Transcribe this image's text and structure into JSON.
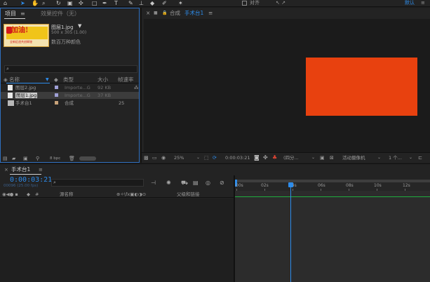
{
  "toolbar": {
    "tools": [
      {
        "icon": "home-icon",
        "glyph": "⌂"
      },
      {
        "icon": "selection-tool-icon",
        "glyph": "➤"
      },
      {
        "icon": "hand-tool-icon",
        "glyph": "✋"
      },
      {
        "icon": "zoom-tool-icon",
        "glyph": "⌕"
      },
      {
        "icon": "rotate-tool-icon",
        "glyph": "↻"
      },
      {
        "icon": "camera-tool-icon",
        "glyph": "▣"
      },
      {
        "icon": "pan-behind-tool-icon",
        "glyph": "✣"
      },
      {
        "icon": "rectangle-tool-icon",
        "glyph": "□"
      },
      {
        "icon": "pen-tool-icon",
        "glyph": "✒"
      },
      {
        "icon": "type-tool-icon",
        "glyph": "T"
      },
      {
        "icon": "brush-tool-icon",
        "glyph": "✎"
      },
      {
        "icon": "clone-stamp-tool-icon",
        "glyph": "⊥"
      },
      {
        "icon": "eraser-tool-icon",
        "glyph": "◆"
      },
      {
        "icon": "roto-brush-tool-icon",
        "glyph": "✐"
      },
      {
        "icon": "puppet-tool-icon",
        "glyph": "✶"
      }
    ],
    "snap_label": "对齐",
    "workspace_label": "默认",
    "workspace_menu": "≡",
    "snap_extra_icons": "↖ ↗"
  },
  "project_panel": {
    "tab_project": "项目",
    "tab_menu": "≡",
    "tab_effects": "效果控件（无）",
    "thumbnail_title": "加油!",
    "thumbnail_caption": "全新征途共创辉煌",
    "asset_name": "图层1.jpg",
    "asset_dropdown": "▼",
    "asset_dims": "500 x 305 (1.00)",
    "asset_colors": "数百万种颜色",
    "search_placeholder": "",
    "search_icon": "⌕",
    "columns": {
      "name": "名称",
      "type": "类型",
      "size": "大小",
      "fps": "帧速率"
    },
    "rows": [
      {
        "name": "图层2.jpg",
        "type": "Importe...G",
        "size": "92 KB",
        "fps": "",
        "label_color": "#9fa0d6",
        "kind": "file"
      },
      {
        "name": "图层1.jpg",
        "type": "Importe...G",
        "size": "37 KB",
        "fps": "",
        "label_color": "#9fa0d6",
        "kind": "file"
      },
      {
        "name": "手术台1",
        "type": "合成",
        "size": "",
        "fps": "25",
        "label_color": "#c8a27a",
        "kind": "comp"
      }
    ],
    "footer_bpc": "8 bpc"
  },
  "comp_panel": {
    "close_icon": "×",
    "menu_icon": "≡",
    "lock_icon": "🔒",
    "tab_prefix": "合成",
    "tab_name": "手术台1",
    "zoom": "25%",
    "timecode": "0:00:03:21",
    "quality": "(四分...",
    "camera": "活动摄像机",
    "views": "1 个...",
    "solid_color": "#e8410f"
  },
  "timeline": {
    "tab_title": "手术台1",
    "tab_menu": "≡",
    "timecode": "0:00:03:21",
    "frames": "00096 (25.00 fps)",
    "search_icon": "⌕",
    "layer_headers": {
      "num": "#",
      "source": "源名称",
      "switches": "⊕✧\\fx▣◐◑⊙",
      "parent": "父级和链接"
    },
    "ruler_labels": [
      "00s",
      "02s",
      "04s",
      "06s",
      "08s",
      "10s",
      "12s"
    ],
    "playhead_color": "#2d8ceb"
  }
}
